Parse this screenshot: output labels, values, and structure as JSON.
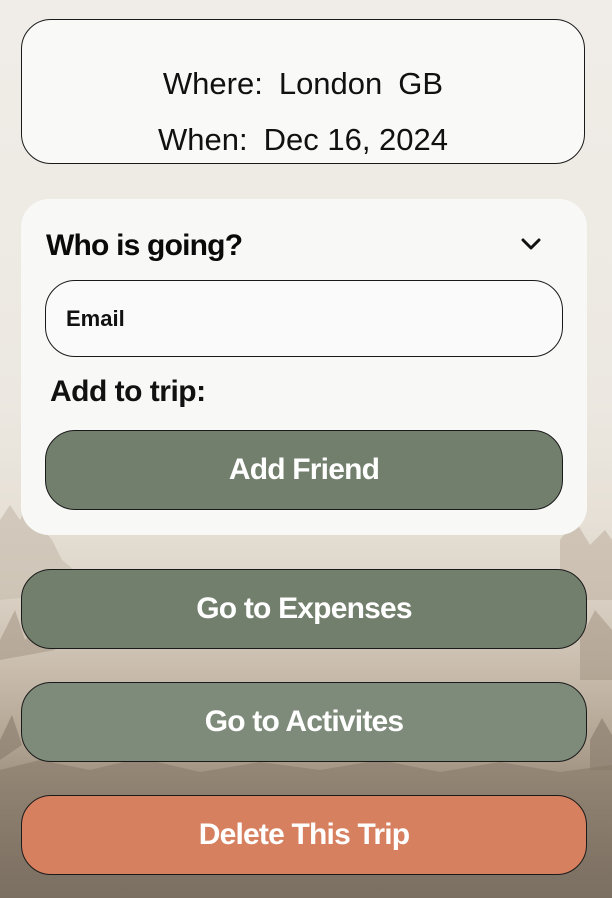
{
  "trip_info": {
    "where_label": "Where:",
    "where_city": "London",
    "where_country": "GB",
    "when_label": "When:",
    "when_date": "Dec 16, 2024"
  },
  "who_panel": {
    "title": "Who is going?",
    "toggle_icon": "chevron-down-icon",
    "email_placeholder": "Email",
    "add_label": "Add to trip:",
    "add_button": "Add Friend"
  },
  "actions": {
    "expenses": "Go to Expenses",
    "activities": "Go to Activites",
    "delete": "Delete This Trip"
  },
  "colors": {
    "primary_button": "#737f6d",
    "secondary_button": "#7f8b7a",
    "danger_button": "#d7805f",
    "card_background": "#f9f9f8"
  }
}
